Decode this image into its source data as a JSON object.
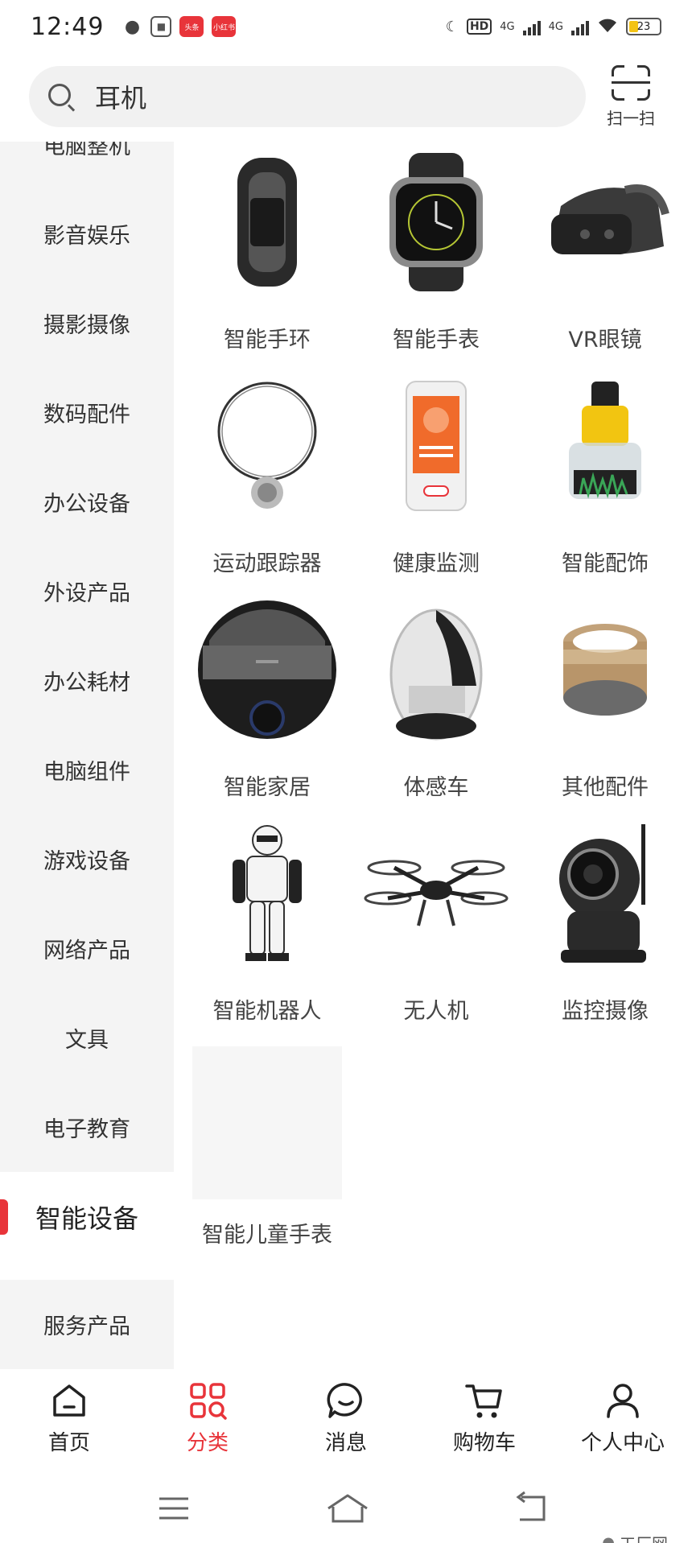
{
  "status_bar": {
    "time": "12:49",
    "hd_label": "HD",
    "net1": "4G",
    "net2": "4G",
    "battery_level": "23",
    "notif_badges": [
      "头条",
      "小红书"
    ]
  },
  "search": {
    "query": "耳机",
    "scan_label": "扫一扫"
  },
  "sidebar": {
    "categories": [
      {
        "label": "电脑整机"
      },
      {
        "label": "影音娱乐"
      },
      {
        "label": "摄影摄像"
      },
      {
        "label": "数码配件"
      },
      {
        "label": "办公设备"
      },
      {
        "label": "外设产品"
      },
      {
        "label": "办公耗材"
      },
      {
        "label": "电脑组件"
      },
      {
        "label": "游戏设备"
      },
      {
        "label": "网络产品"
      },
      {
        "label": "文具"
      },
      {
        "label": "电子教育"
      },
      {
        "label": "智能设备"
      },
      {
        "label": "服务产品"
      }
    ],
    "active": "智能设备"
  },
  "grid": {
    "items": [
      {
        "label": "智能手环",
        "icon": "smart-band-icon"
      },
      {
        "label": "智能手表",
        "icon": "smart-watch-icon"
      },
      {
        "label": "VR眼镜",
        "icon": "vr-headset-icon"
      },
      {
        "label": "运动跟踪器",
        "icon": "fitness-tracker-icon"
      },
      {
        "label": "健康监测",
        "icon": "health-monitor-icon"
      },
      {
        "label": "智能配饰",
        "icon": "smart-accessory-icon"
      },
      {
        "label": "智能家居",
        "icon": "robot-vacuum-icon"
      },
      {
        "label": "体感车",
        "icon": "unicycle-icon"
      },
      {
        "label": "其他配件",
        "icon": "ring-icon"
      },
      {
        "label": "智能机器人",
        "icon": "robot-icon"
      },
      {
        "label": "无人机",
        "icon": "drone-icon"
      },
      {
        "label": "监控摄像",
        "icon": "security-camera-icon"
      },
      {
        "label": "智能儿童手表",
        "icon": "placeholder"
      }
    ]
  },
  "bottom_nav": {
    "items": [
      {
        "label": "首页",
        "icon": "home-icon"
      },
      {
        "label": "分类",
        "icon": "category-icon"
      },
      {
        "label": "消息",
        "icon": "message-icon"
      },
      {
        "label": "购物车",
        "icon": "cart-icon"
      },
      {
        "label": "个人中心",
        "icon": "user-icon"
      }
    ],
    "active": "分类"
  },
  "watermark": "工厂网",
  "colors": {
    "accent": "#e8343a",
    "sidebar_bg": "#f4f4f4",
    "search_bg": "#f1f1f1"
  }
}
